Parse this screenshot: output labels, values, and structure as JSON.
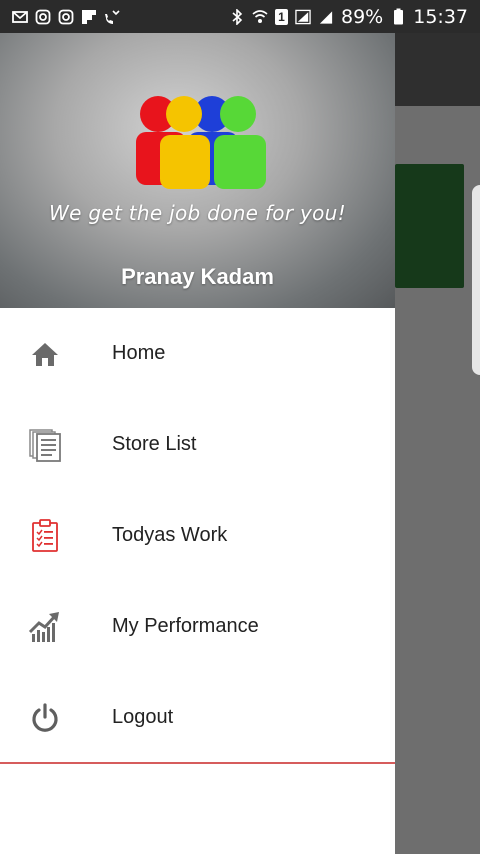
{
  "status_bar": {
    "battery_percent": "89%",
    "time": "15:37",
    "sim_label": "1",
    "left_icons": [
      "gmail-icon",
      "instagram-icon",
      "instagram-icon",
      "flipboard-icon",
      "missed-call-icon"
    ],
    "right_icons": [
      "bluetooth-icon",
      "wifi-icon",
      "sim-icon",
      "signal-icon",
      "signal-icon",
      "battery-icon"
    ]
  },
  "drawer": {
    "tagline": "We get the job done for you!",
    "user_name": "Pranay Kadam",
    "logo_colors": [
      "#e8141c",
      "#f5c400",
      "#1e3fd8",
      "#57d837"
    ],
    "menu": [
      {
        "label": "Home",
        "icon": "home-icon"
      },
      {
        "label": "Store List",
        "icon": "store-list-icon"
      },
      {
        "label": "Todyas Work",
        "icon": "clipboard-icon"
      },
      {
        "label": "My Performance",
        "icon": "performance-chart-icon"
      },
      {
        "label": "Logout",
        "icon": "power-icon"
      }
    ]
  },
  "colors": {
    "status_bar": "#2b2b2b",
    "divider": "#d65c5c",
    "background_card": "#16391a"
  }
}
